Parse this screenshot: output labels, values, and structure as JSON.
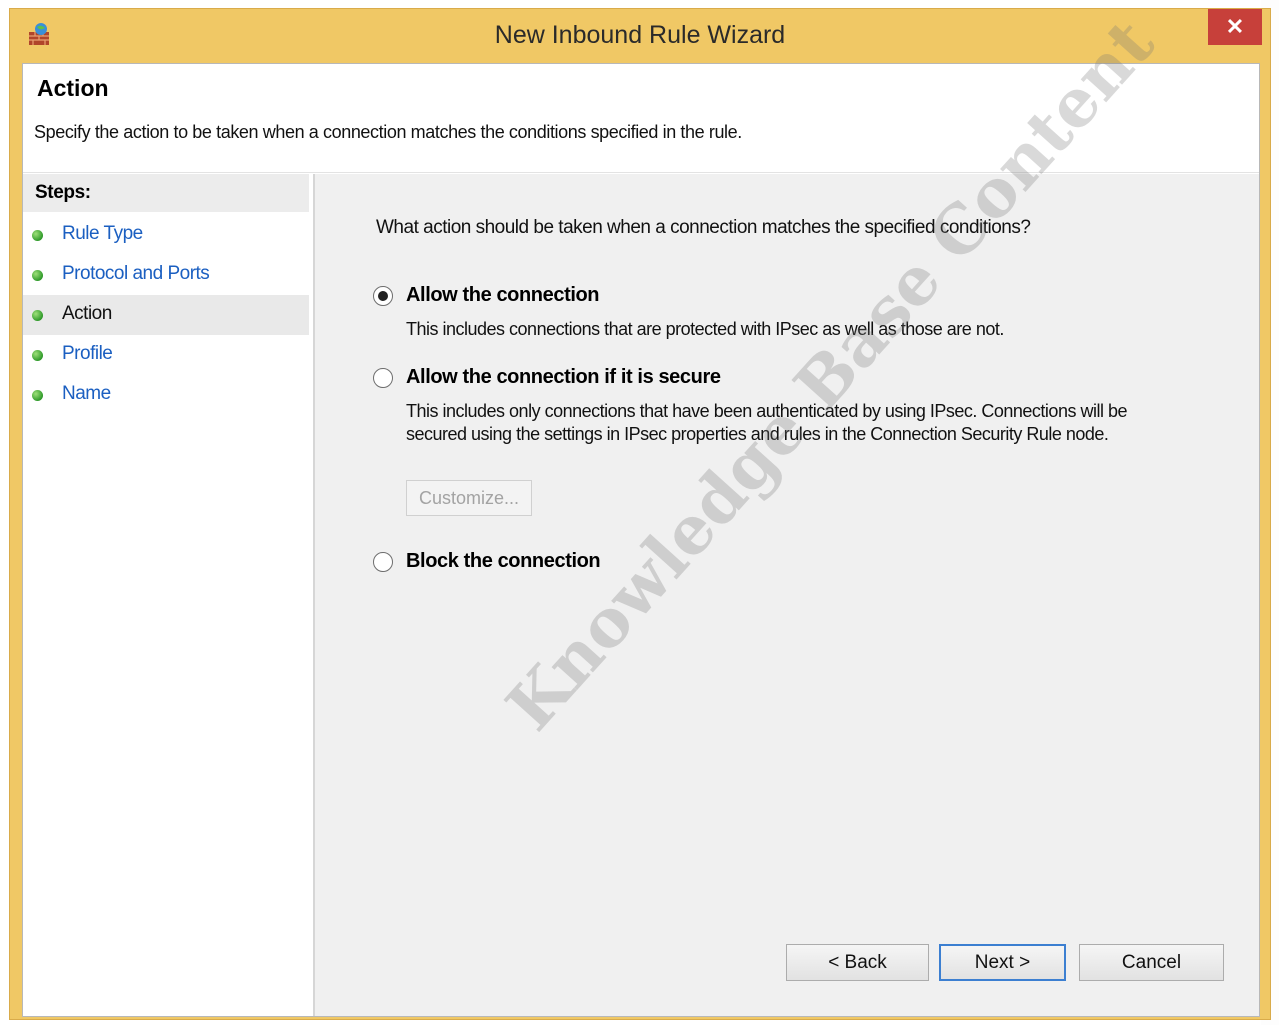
{
  "window": {
    "title": "New Inbound Rule Wizard",
    "close_glyph": "✕"
  },
  "header": {
    "title": "Action",
    "subtitle": "Specify the action to be taken when a connection matches the conditions specified in the rule."
  },
  "steps": {
    "heading": "Steps:",
    "items": [
      {
        "label": "Rule Type"
      },
      {
        "label": "Protocol and Ports"
      },
      {
        "label": "Action"
      },
      {
        "label": "Profile"
      },
      {
        "label": "Name"
      }
    ]
  },
  "main": {
    "question": "What action should be taken when a connection matches the specified conditions?",
    "options": [
      {
        "label": "Allow the connection",
        "description": "This includes connections that are protected with IPsec as well as those are not.",
        "selected": true
      },
      {
        "label": "Allow the connection if it is secure",
        "description": "This includes only connections that have been authenticated by using IPsec.  Connections will be secured using the settings in IPsec properties and rules in the Connection Security Rule node.",
        "selected": false
      },
      {
        "label": "Block the connection",
        "selected": false
      }
    ],
    "customize_label": "Customize..."
  },
  "buttons": {
    "back": "< Back",
    "next": "Next >",
    "cancel": "Cancel"
  },
  "watermark": "Knowledge Base Content",
  "colors": {
    "titlebar": "#f0c865",
    "close": "#c7403a",
    "link": "#1b5fc1",
    "panel": "#f0f0f0"
  }
}
